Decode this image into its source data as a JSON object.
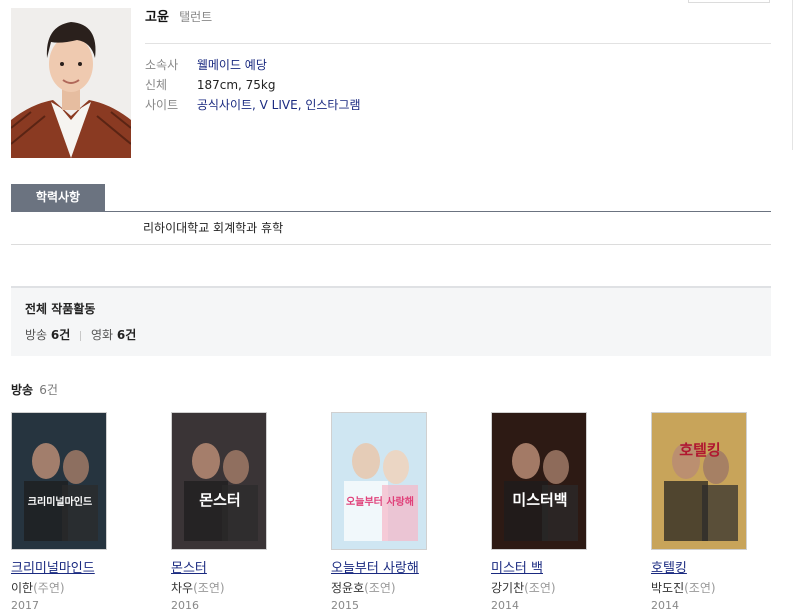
{
  "profile": {
    "name": "고윤",
    "job": "탤런트",
    "agency_label": "소속사",
    "agency_value": "웰메이드 예당",
    "body_label": "신체",
    "body_value": "187cm, 75kg",
    "site_label": "사이트",
    "site_value": "공식사이트, V LIVE, 인스타그램"
  },
  "education": {
    "tab_label": "학력사항",
    "entry": "리하이대학교 회계학과 휴학"
  },
  "summary": {
    "title": "전체 작품활동",
    "broadcast_label": "방송",
    "broadcast_count": "6건",
    "movie_label": "영화",
    "movie_count": "6건"
  },
  "broadcast_section": {
    "label": "방송",
    "count": "6건"
  },
  "works": [
    {
      "title": "크리미널마인드",
      "role": "이한",
      "role_type": "(주연)",
      "year": "2017",
      "poster_text": "크리미널마인드",
      "poster_color": "#26343f"
    },
    {
      "title": "몬스터",
      "role": "차우",
      "role_type": "(조연)",
      "year": "2016",
      "poster_text": "몬스터",
      "poster_color": "#3a3436"
    },
    {
      "title": "오늘부터 사랑해",
      "role": "정윤호",
      "role_type": "(조연)",
      "year": "2015",
      "poster_text": "오늘부터 사랑해",
      "poster_color": "#cfe6f2"
    },
    {
      "title": "미스터 백",
      "role": "강기찬",
      "role_type": "(조연)",
      "year": "2014",
      "poster_text": "미스터백",
      "poster_color": "#2d1a14"
    },
    {
      "title": "호텔킹",
      "role": "박도진",
      "role_type": "(조연)",
      "year": "2014",
      "poster_text": "호텔킹",
      "poster_color": "#c8a45a"
    }
  ]
}
